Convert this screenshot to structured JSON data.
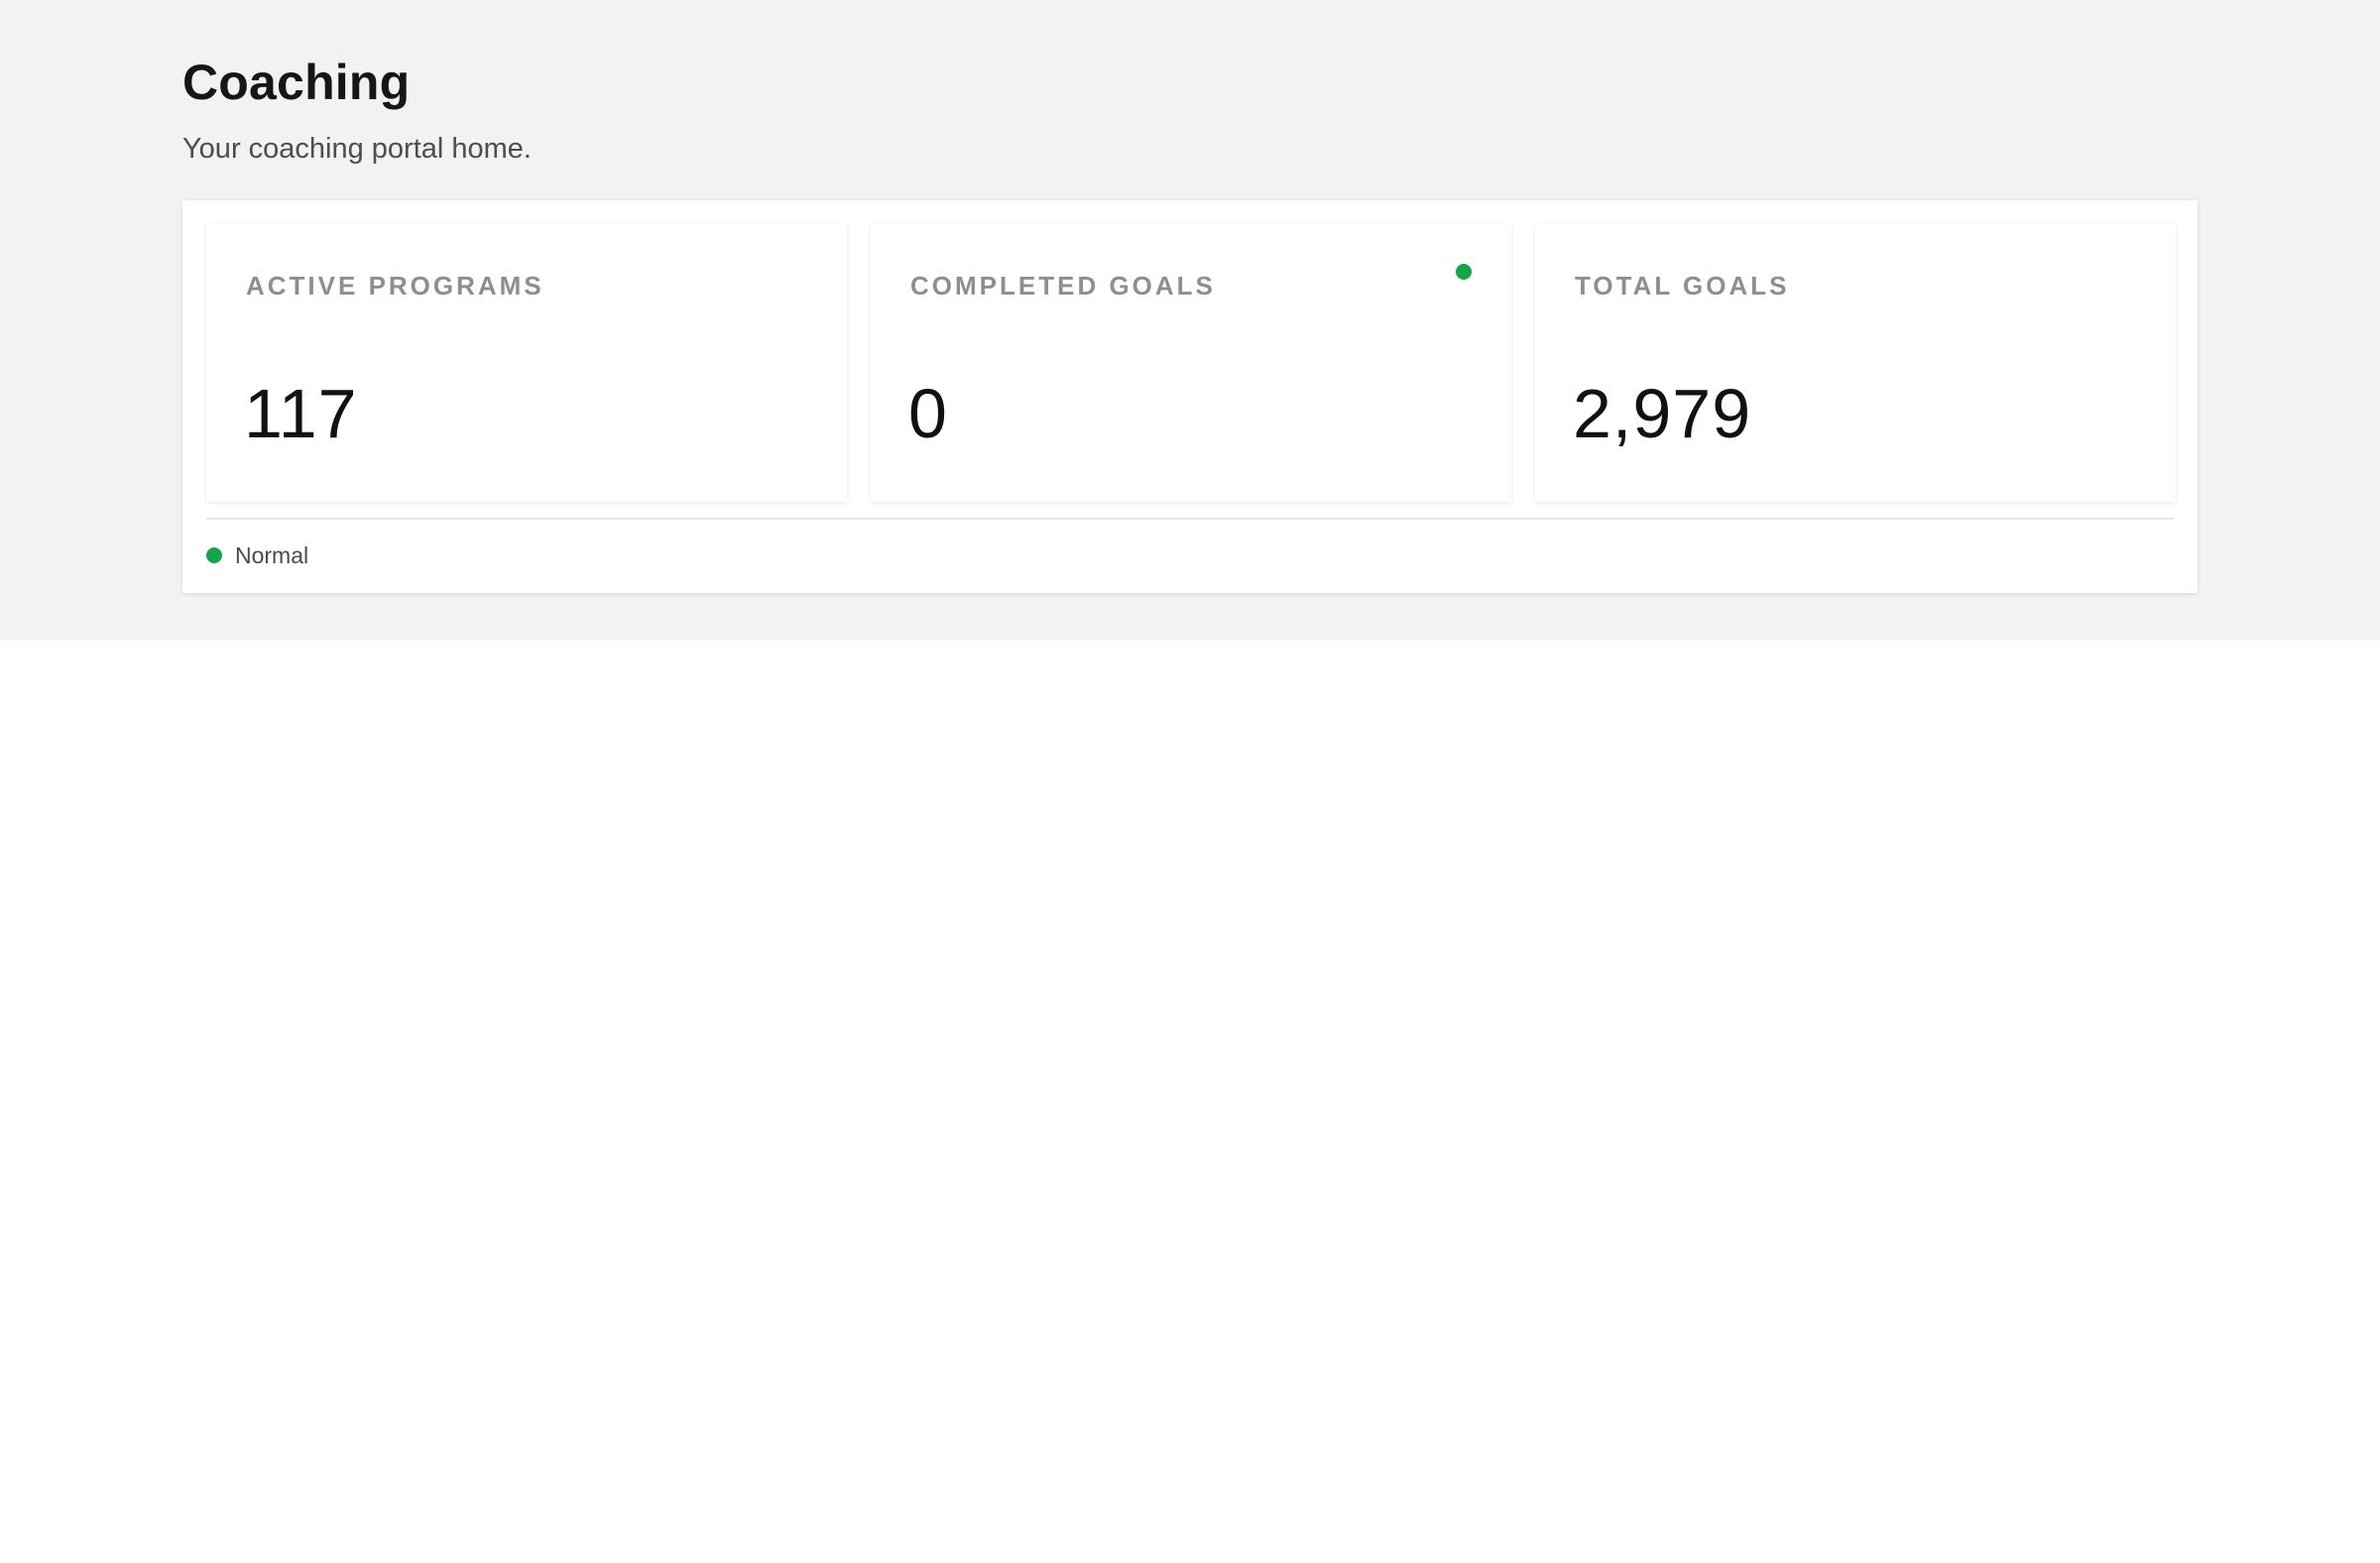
{
  "page": {
    "title": "Coaching",
    "subtitle": "Your coaching portal home."
  },
  "stats": [
    {
      "label": "ACTIVE PROGRAMS",
      "value": "117"
    },
    {
      "label": "COMPLETED GOALS",
      "value": "0",
      "status_indicator": "green-dot"
    },
    {
      "label": "TOTAL GOALS",
      "value": "2,979"
    }
  ],
  "legend": {
    "label": "Normal",
    "color": "#16a34a"
  },
  "colors": {
    "status_normal": "#16a34a",
    "header_background": "#f2f2f2"
  }
}
